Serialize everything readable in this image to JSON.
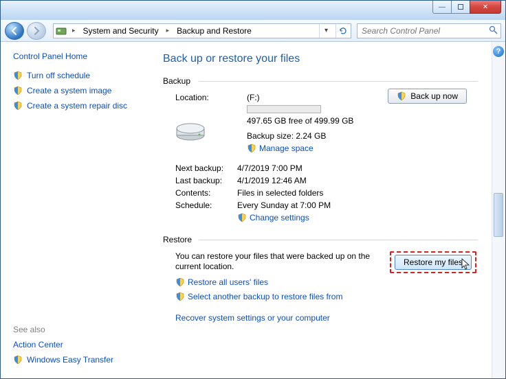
{
  "titlebar": {
    "min": "—",
    "close": "✕"
  },
  "toolbar": {
    "crumb1": "System and Security",
    "crumb2": "Backup and Restore",
    "search_placeholder": "Search Control Panel"
  },
  "sidebar": {
    "home": "Control Panel Home",
    "tasks": [
      {
        "label": "Turn off schedule"
      },
      {
        "label": "Create a system image"
      },
      {
        "label": "Create a system repair disc"
      }
    ],
    "seealso_hd": "See also",
    "seealso": [
      {
        "label": "Action Center",
        "shield": false
      },
      {
        "label": "Windows Easy Transfer",
        "shield": true
      }
    ]
  },
  "main": {
    "header": "Back up or restore your files",
    "backup": {
      "title": "Backup",
      "location_lbl": "Location:",
      "location_val": "(F:)",
      "free": "497.65 GB free of 499.99 GB",
      "size": "Backup size: 2.24 GB",
      "manage": "Manage space",
      "backup_now": "Back up now",
      "rows": [
        {
          "lbl": "Next backup:",
          "val": "4/7/2019 7:00 PM"
        },
        {
          "lbl": "Last backup:",
          "val": "4/1/2019 12:46 AM"
        },
        {
          "lbl": "Contents:",
          "val": "Files in selected folders"
        },
        {
          "lbl": "Schedule:",
          "val": "Every Sunday at 7:00 PM"
        }
      ],
      "change": "Change settings"
    },
    "restore": {
      "title": "Restore",
      "text": "You can restore your files that were backed up on the current location.",
      "btn": "Restore my files",
      "all": "Restore all users' files",
      "another": "Select another backup to restore files from",
      "recover": "Recover system settings or your computer"
    }
  }
}
